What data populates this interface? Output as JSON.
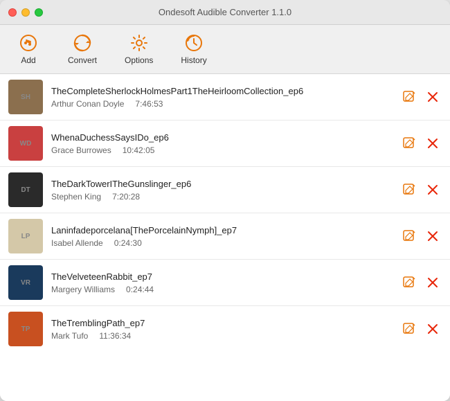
{
  "window": {
    "title": "Ondesoft Audible Converter 1.1.0"
  },
  "toolbar": {
    "add_label": "Add",
    "convert_label": "Convert",
    "options_label": "Options",
    "history_label": "History"
  },
  "items": [
    {
      "id": 1,
      "title": "TheCompleteSherlockHolmesPart1TheHeirloomCollection_ep6",
      "author": "Arthur Conan Doyle",
      "duration": "7:46:53",
      "thumb_text": "SH",
      "thumb_class": "thumb-1"
    },
    {
      "id": 2,
      "title": "WhenaDuchessSaysIDo_ep6",
      "author": "Grace Burrowes",
      "duration": "10:42:05",
      "thumb_text": "WD",
      "thumb_class": "thumb-2"
    },
    {
      "id": 3,
      "title": "TheDarkTowerITheGunslinger_ep6",
      "author": "Stephen King",
      "duration": "7:20:28",
      "thumb_text": "DT",
      "thumb_class": "thumb-3"
    },
    {
      "id": 4,
      "title": "Laninfadeporcelana[ThePorcelainNymph]_ep7",
      "author": "Isabel Allende",
      "duration": "0:24:30",
      "thumb_text": "LP",
      "thumb_class": "thumb-4"
    },
    {
      "id": 5,
      "title": "TheVelveteenRabbit_ep7",
      "author": "Margery Williams",
      "duration": "0:24:44",
      "thumb_text": "VR",
      "thumb_class": "thumb-5"
    },
    {
      "id": 6,
      "title": "TheTremblingPath_ep7",
      "author": "Mark Tufo",
      "duration": "11:36:34",
      "thumb_text": "TP",
      "thumb_class": "thumb-6"
    }
  ]
}
